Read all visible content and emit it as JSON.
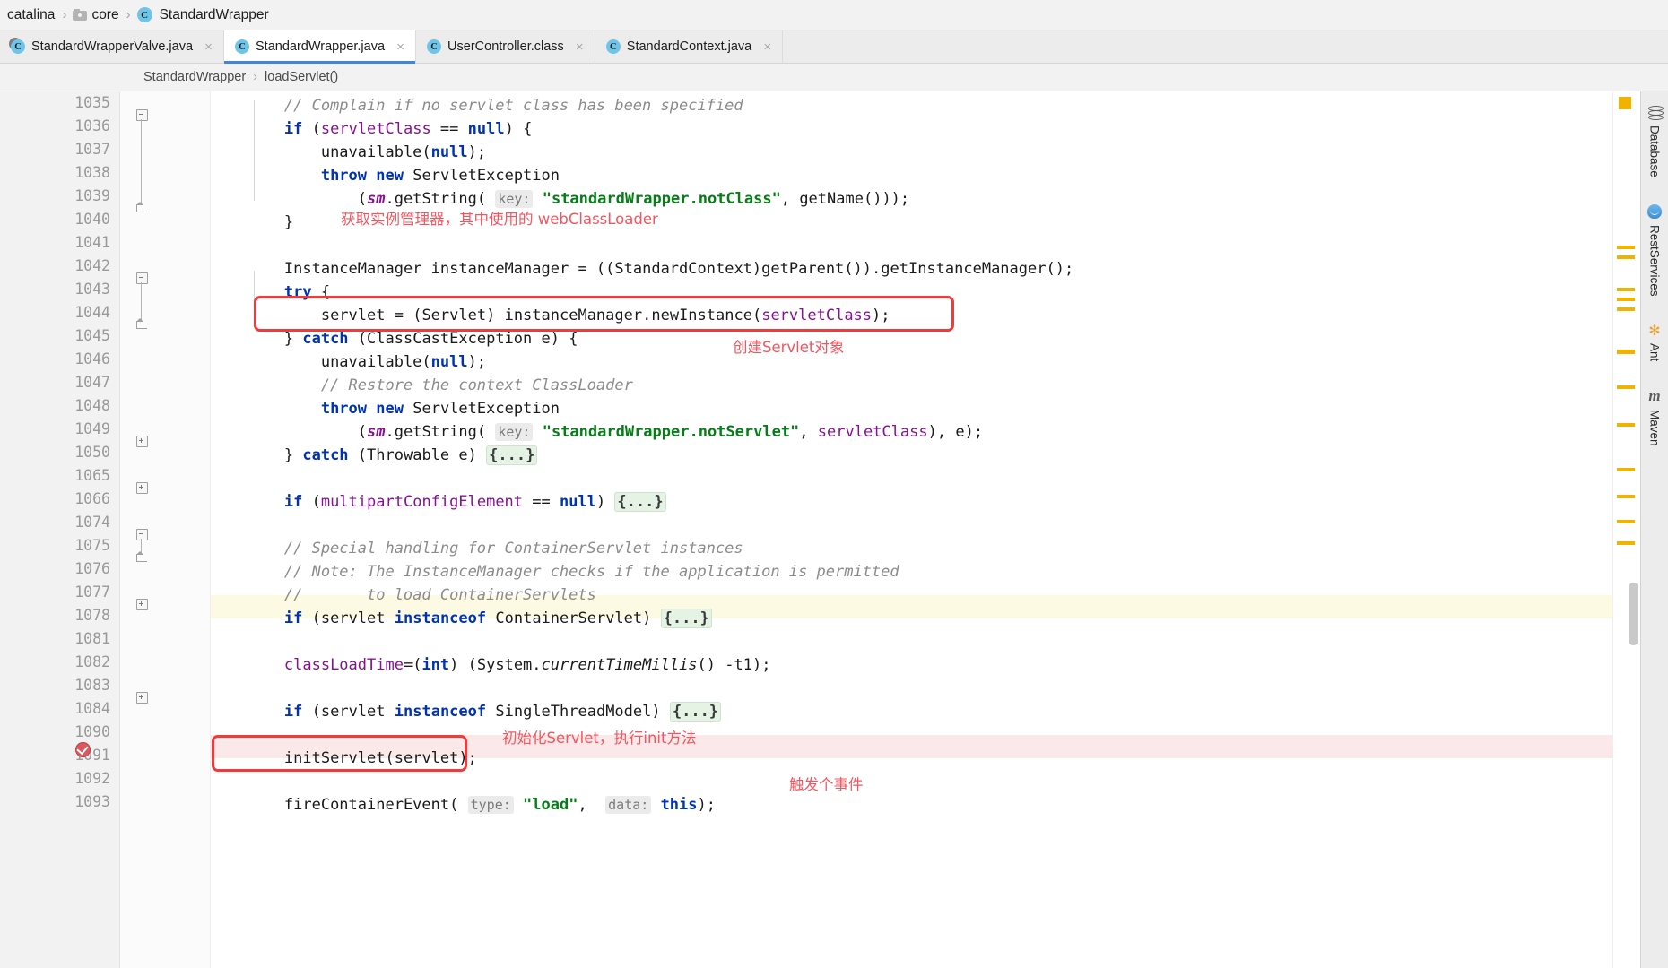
{
  "navbar": {
    "crumbs": [
      {
        "label": "catalina",
        "icon": "none"
      },
      {
        "label": "core",
        "icon": "folder-icon"
      },
      {
        "label": "StandardWrapper",
        "icon": "java-class-icon"
      }
    ],
    "separator": "›"
  },
  "tabs": [
    {
      "label": "StandardWrapperValve.java",
      "icon": "java-class-icon",
      "active": false,
      "close": "×",
      "modified": true
    },
    {
      "label": "StandardWrapper.java",
      "icon": "java-class-icon",
      "active": true,
      "close": "×",
      "modified": false
    },
    {
      "label": "UserController.class",
      "icon": "java-class-icon",
      "active": false,
      "close": "×",
      "modified": false
    },
    {
      "label": "StandardContext.java",
      "icon": "java-class-icon",
      "active": false,
      "close": "×",
      "modified": false
    }
  ],
  "breadcrumb": {
    "class_name": "StandardWrapper",
    "separator": "›",
    "method_name": "loadServlet()"
  },
  "editor": {
    "line_numbers": [
      "1035",
      "1036",
      "1037",
      "1038",
      "1039",
      "1040",
      "1041",
      "1042",
      "1043",
      "1044",
      "1045",
      "1046",
      "1047",
      "1048",
      "1049",
      "1050",
      "1065",
      "1066",
      "1074",
      "1075",
      "1076",
      "1077",
      "1078",
      "1081",
      "1082",
      "1083",
      "1084",
      "1090",
      "1091",
      "1092",
      "1093"
    ],
    "lines": [
      {
        "n": "1035",
        "text": "        // Complain if no servlet class has been specified"
      },
      {
        "n": "1036",
        "text": "        if (servletClass == null) {"
      },
      {
        "n": "1037",
        "text": "            unavailable(null);"
      },
      {
        "n": "1038",
        "text": "            throw new ServletException"
      },
      {
        "n": "1039",
        "text": "                (sm.getString( key: \"standardWrapper.notClass\", getName()));"
      },
      {
        "n": "1040",
        "text": "        }"
      },
      {
        "n": "1041",
        "text": ""
      },
      {
        "n": "1042",
        "text": "        InstanceManager instanceManager = ((StandardContext)getParent()).getInstanceManager();"
      },
      {
        "n": "1043",
        "text": "        try {"
      },
      {
        "n": "1044",
        "text": "            servlet = (Servlet) instanceManager.newInstance(servletClass);"
      },
      {
        "n": "1045",
        "text": "        } catch (ClassCastException e) {"
      },
      {
        "n": "1046",
        "text": "            unavailable(null);"
      },
      {
        "n": "1047",
        "text": "            // Restore the context ClassLoader"
      },
      {
        "n": "1048",
        "text": "            throw new ServletException"
      },
      {
        "n": "1049",
        "text": "                (sm.getString( key: \"standardWrapper.notServlet\", servletClass), e);"
      },
      {
        "n": "1050",
        "text": "        } catch (Throwable e) {...}"
      },
      {
        "n": "1065",
        "text": ""
      },
      {
        "n": "1066",
        "text": "        if (multipartConfigElement == null) {...}"
      },
      {
        "n": "1074",
        "text": ""
      },
      {
        "n": "1075",
        "text": "        // Special handling for ContainerServlet instances"
      },
      {
        "n": "1076",
        "text": "        // Note: The InstanceManager checks if the application is permitted"
      },
      {
        "n": "1077",
        "text": "        //       to load ContainerServlets"
      },
      {
        "n": "1078",
        "text": "        if (servlet instanceof ContainerServlet) {...}"
      },
      {
        "n": "1081",
        "text": ""
      },
      {
        "n": "1082",
        "text": "        classLoadTime=(int) (System.currentTimeMillis() -t1);"
      },
      {
        "n": "1083",
        "text": ""
      },
      {
        "n": "1084",
        "text": "        if (servlet instanceof SingleThreadModel) {...}"
      },
      {
        "n": "1090",
        "text": ""
      },
      {
        "n": "1091",
        "text": "        initServlet(servlet);"
      },
      {
        "n": "1092",
        "text": ""
      },
      {
        "n": "1093",
        "text": "        fireContainerEvent( type: \"load\",  data: this);"
      }
    ],
    "annotations": [
      {
        "id": "ann-1",
        "text": "获取实例管理器，其中使用的 webClassLoader"
      },
      {
        "id": "ann-2",
        "text": "创建Servlet对象"
      },
      {
        "id": "ann-3",
        "text": "初始化Servlet，执行init方法"
      },
      {
        "id": "ann-4",
        "text": "触发个事件"
      }
    ],
    "breakpoint_line": "1091",
    "highlight_color": "#ef3b3b",
    "annotation_color": "#f5555f"
  },
  "toolstrip": {
    "buttons": [
      {
        "label": "Database",
        "icon": "database-icon"
      },
      {
        "label": "RestServices",
        "icon": "rest-services-icon"
      },
      {
        "label": "Ant",
        "icon": "ant-icon"
      },
      {
        "label": "Maven",
        "icon": "maven-icon"
      }
    ],
    "ant_glyph": "✻",
    "maven_glyph": "m"
  }
}
